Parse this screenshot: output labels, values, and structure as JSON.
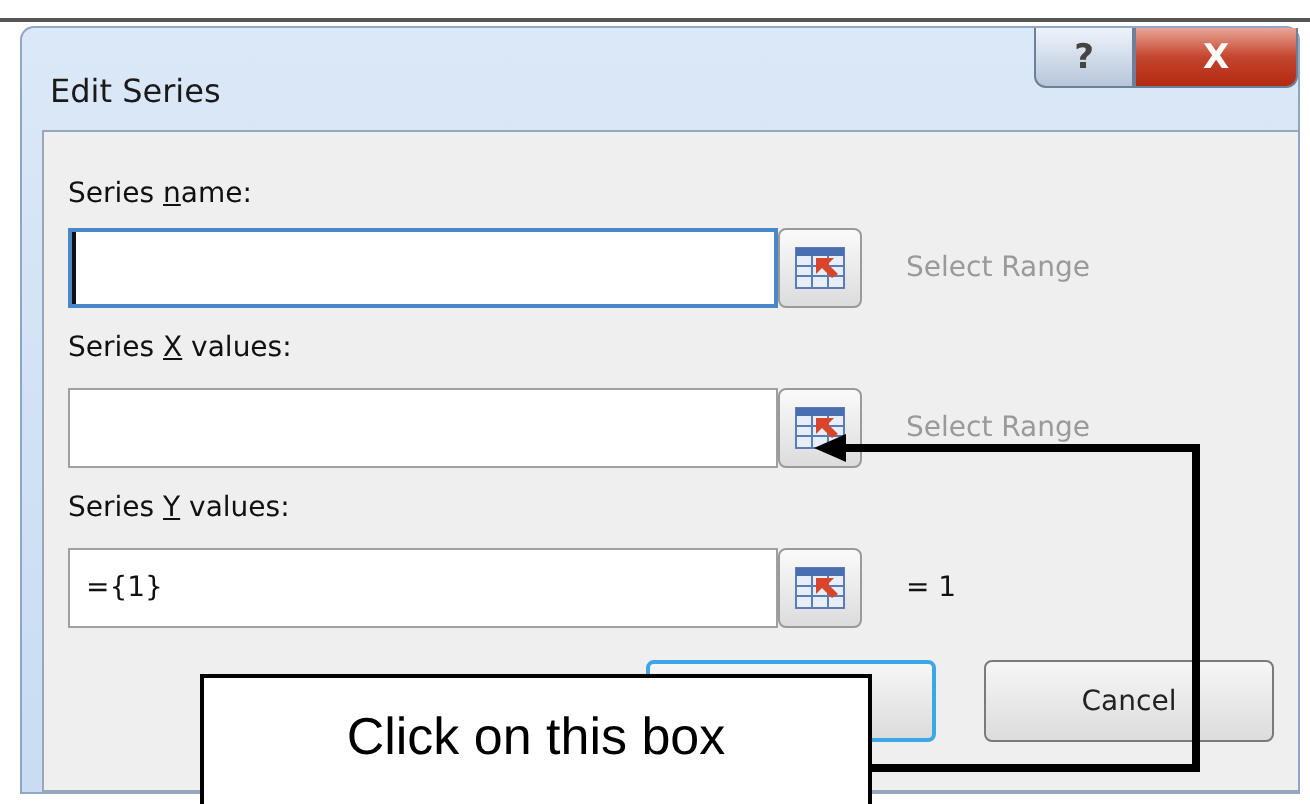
{
  "window": {
    "title": "Edit Series",
    "help_button": "?",
    "close_button": "X"
  },
  "fields": [
    {
      "label": {
        "before": "Series ",
        "key": "n",
        "after": "ame:"
      },
      "focused": true,
      "hint": "Select Range"
    },
    {
      "label": {
        "before": "Series ",
        "key": "X",
        "after": " values:"
      },
      "focused": false,
      "hint": "Select Range"
    },
    {
      "label": {
        "before": "Series ",
        "key": "Y",
        "after": " values:"
      },
      "value": "={1}",
      "focused": false,
      "hint": "= 1"
    }
  ],
  "buttons": [
    {
      "kind": "default"
    },
    {
      "kind": "normal",
      "label": "Cancel"
    }
  ],
  "callout": {
    "text": "Click on this box"
  }
}
